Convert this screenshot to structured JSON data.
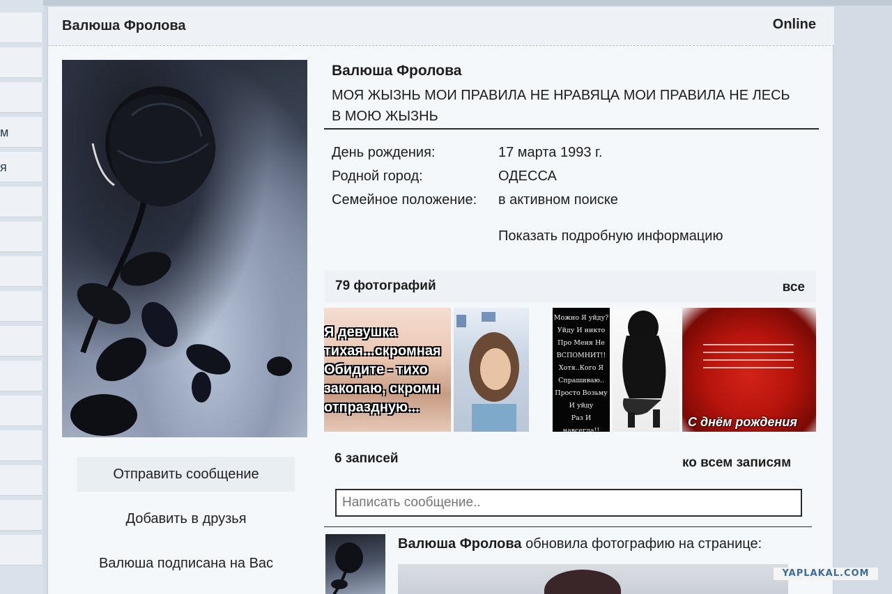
{
  "left_strip": {
    "items": [
      "",
      "",
      "",
      "м",
      "я",
      "",
      "",
      "",
      "",
      "",
      "",
      "",
      "",
      "",
      "",
      "",
      ""
    ]
  },
  "header": {
    "name": "Валюша Фролова",
    "status": "Online"
  },
  "profile": {
    "name": "Валюша Фролова",
    "status_text": "МОЯ ЖЫЗНЬ МОИ ПРАВИЛА НЕ НРАВЯЦА МОИ ПРАВИЛА НЕ ЛЕСЬ В МОЮ ЖЫЗНЬ",
    "info": [
      {
        "label": "День рождения:",
        "value": "17 марта 1993 г."
      },
      {
        "label": "Родной город:",
        "value": "ОДЕССА"
      },
      {
        "label": "Семейное положение:",
        "value": "в активном поиске"
      }
    ],
    "more_link": "Показать подробную информацию"
  },
  "actions": {
    "send_message": "Отправить сообщение",
    "add_friend": "Добавить в друзья",
    "subscribed": "Валюша подписана на Вас"
  },
  "photos": {
    "count_label": "79 фотографий",
    "all_link": "все",
    "thumb1_text": [
      "Я девушка",
      "тихая...скромная",
      "Обидите - тихо",
      "закопаю, скромн",
      "отпраздную..."
    ],
    "thumb3_text": [
      "Можно Я уйду?",
      "Уйду И никто",
      "Про Меня Не",
      "ВСПОМНИТ!!",
      "Хотя..Кого Я",
      "Спрашиваю..",
      "Просто Возьму",
      "И уйду",
      "Раз И навсегда!!"
    ],
    "thumb5_caption": "С днём рождения"
  },
  "wall": {
    "count_label": "6 записей",
    "all_link": "ко всем записям",
    "input_placeholder": "Написать сообщение..",
    "post_author": "Валюша Фролова",
    "post_action": " обновила фотографию на странице:"
  },
  "watermark": "YAPLAKAL.COM",
  "colors": {
    "panel_bg": "#f5f8fb",
    "header_bg": "#eef2f6",
    "page_bg": "#d3dbe4",
    "watermark": "#3c6d9a"
  }
}
